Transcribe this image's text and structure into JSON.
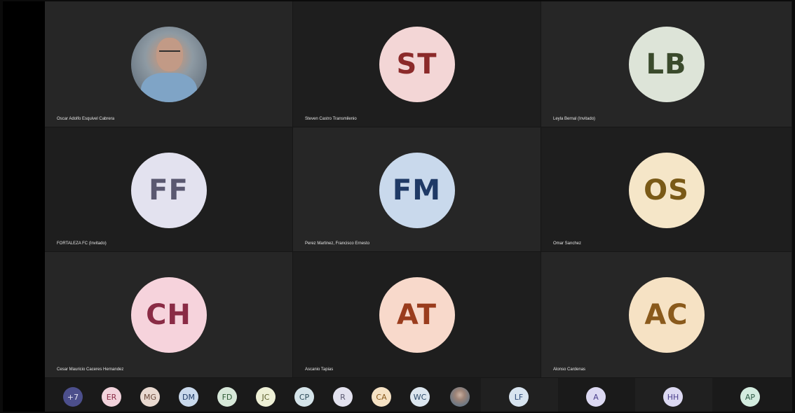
{
  "participants": [
    {
      "name": "Oscar Adolfo Esquivel Cabrera",
      "initials": "",
      "type": "photo",
      "bg": "",
      "fg": ""
    },
    {
      "name": "Steven Castro Transmilenio",
      "initials": "ST",
      "type": "initials",
      "bg": "#f3d6d6",
      "fg": "#8b2a2a"
    },
    {
      "name": "Leyla Bernal (Invitado)",
      "initials": "LB",
      "type": "initials",
      "bg": "#dde4d8",
      "fg": "#3a4a2c"
    },
    {
      "name": "FORTALEZA FC (Invitado)",
      "initials": "FF",
      "type": "initials",
      "bg": "#e3e2ef",
      "fg": "#5a5870"
    },
    {
      "name": "Perez Martinez, Francisco Ernesto",
      "initials": "FM",
      "type": "initials",
      "bg": "#c9d9ec",
      "fg": "#1f3a66"
    },
    {
      "name": "Omar Sanchez",
      "initials": "OS",
      "type": "initials",
      "bg": "#f5e6c8",
      "fg": "#7a5a17"
    },
    {
      "name": "Cesar Mauricio Caceres Hernandez",
      "initials": "CH",
      "type": "initials",
      "bg": "#f6d3dc",
      "fg": "#8a2b45"
    },
    {
      "name": "Ascanio Tapias",
      "initials": "AT",
      "type": "initials",
      "bg": "#f8d9cb",
      "fg": "#9a3c1d"
    },
    {
      "name": "Alonso Cardenas",
      "initials": "AC",
      "type": "initials",
      "bg": "#f6e2c4",
      "fg": "#8a5a1c"
    }
  ],
  "strip": [
    {
      "label": "+7",
      "bg": "#4c4f8c",
      "fg": "#e6e6f5",
      "type": "initials"
    },
    {
      "label": "ER",
      "bg": "#f2d3dc",
      "fg": "#8a2b45",
      "type": "initials"
    },
    {
      "label": "MG",
      "bg": "#e9d9d0",
      "fg": "#6b4a3a",
      "type": "initials"
    },
    {
      "label": "DM",
      "bg": "#c9d9ec",
      "fg": "#1f3a66",
      "type": "initials"
    },
    {
      "label": "FD",
      "bg": "#d7e8d9",
      "fg": "#2c5a34",
      "type": "initials"
    },
    {
      "label": "JC",
      "bg": "#eef0d6",
      "fg": "#5a5c2a",
      "type": "initials"
    },
    {
      "label": "CP",
      "bg": "#d5e4ea",
      "fg": "#2c4a58",
      "type": "initials"
    },
    {
      "label": "R",
      "bg": "#e3e2ef",
      "fg": "#5a5870",
      "type": "initials"
    },
    {
      "label": "CA",
      "bg": "#f6e2c4",
      "fg": "#8a5a1c",
      "type": "initials"
    },
    {
      "label": "WC",
      "bg": "#dce6ef",
      "fg": "#2c4a68",
      "type": "initials"
    },
    {
      "label": "",
      "bg": "",
      "fg": "",
      "type": "photo"
    },
    {
      "label": "LF",
      "bg": "#d8e4f0",
      "fg": "#2c4a78",
      "type": "initials"
    },
    {
      "label": "A",
      "bg": "#dcd9f2",
      "fg": "#4a3f8c",
      "type": "initials"
    },
    {
      "label": "HH",
      "bg": "#dcd9f2",
      "fg": "#4a3f8c",
      "type": "initials"
    },
    {
      "label": "AP",
      "bg": "#d3ecdf",
      "fg": "#2c5a44",
      "type": "initials"
    }
  ]
}
